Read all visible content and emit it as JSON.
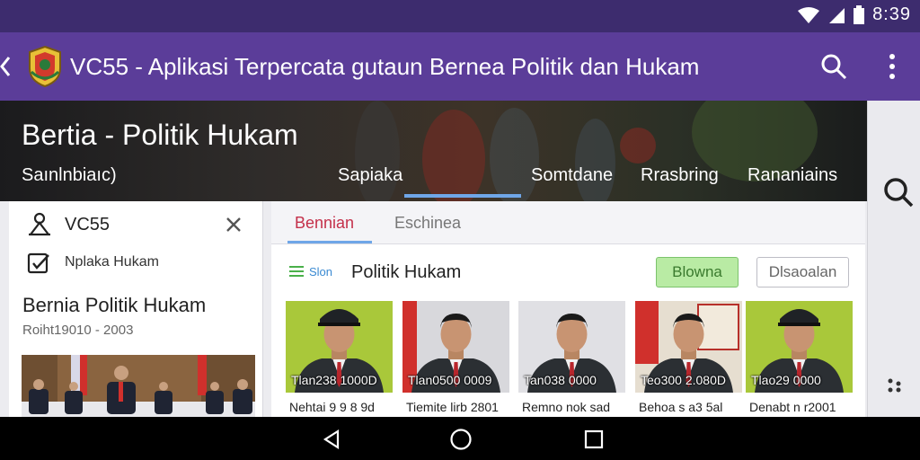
{
  "status_bar": {
    "time": "8:39"
  },
  "app_bar": {
    "title": "VC55 - Aplikasi Terpercata gutaun Bernea Politik dan Hukam"
  },
  "hero": {
    "title": "Bertia - Politik Hukam",
    "subtitle": "Saınlnbiaıc)",
    "tabs": [
      "Sapiaka",
      "Somtdane",
      "Rrasbring",
      "Rananiains"
    ],
    "active_tab_index": 0
  },
  "side_panel": {
    "app_name": "VC55",
    "subtitle": "Nplaka Hukam",
    "news_title": "Bernia Politik Hukam",
    "news_date": "Roiht19010 - 2003"
  },
  "main_panel": {
    "tabs": [
      "Bennian",
      "Eschinea"
    ],
    "section_tag": "Slon",
    "section_title": "Politik Hukam",
    "primary_button": "Blowna",
    "secondary_button": "Dlsaoalan",
    "profiles": [
      {
        "caption": "Tlan238  1000D",
        "name": "Nehtai 9 9 8 9d",
        "bg": "#a9c83a"
      },
      {
        "caption": "Tlan0500  0009",
        "name": "Tiemite lirb 2801",
        "bg": "#d8d8dc"
      },
      {
        "caption": "Tan038  0000",
        "name": "Remno nok sad",
        "bg": "#e0e0e4"
      },
      {
        "caption": "Teo300 2.080D",
        "name": "Behoa s a3 5al",
        "bg": "#e6ded0"
      },
      {
        "caption": "Tlao29  0000",
        "name": "Denabt n r2001",
        "bg": "#a9c83a"
      }
    ]
  },
  "colors": {
    "status_bar": "#3d2c6e",
    "app_bar": "#5b3d99",
    "accent_tab": "#c4304a",
    "indicator": "#6fa6e8",
    "primary_button": "#b9eba4"
  },
  "icons": {
    "back": "chevron-left-icon",
    "search": "search-icon",
    "more": "more-vert-icon",
    "wifi": "wifi-icon",
    "signal": "signal-icon",
    "battery": "battery-icon",
    "close": "close-icon",
    "checkbox": "checkbox-icon",
    "dots": "dots-icon",
    "nav_back": "triangle-back-icon",
    "nav_home": "circle-home-icon",
    "nav_recents": "square-recents-icon"
  }
}
